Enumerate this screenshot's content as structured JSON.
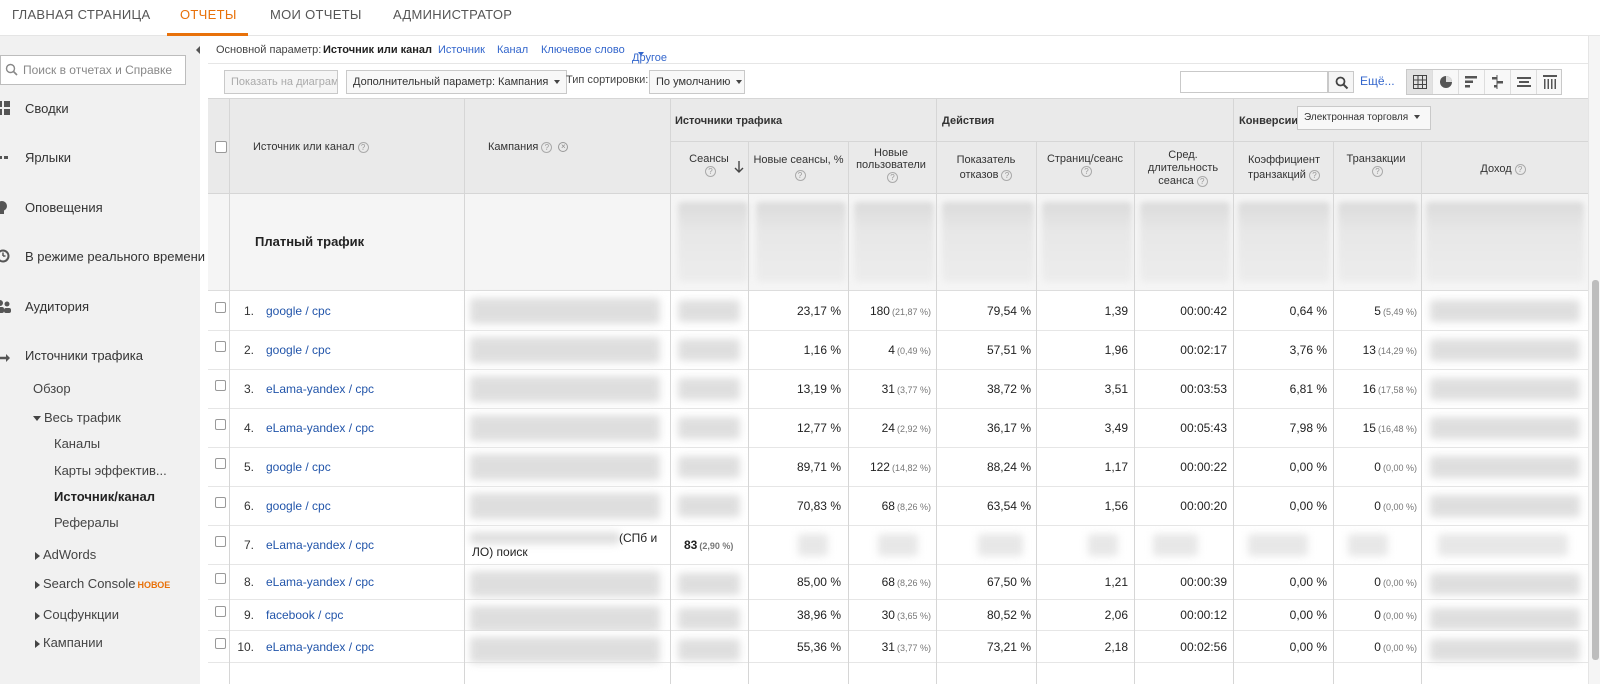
{
  "topnav": {
    "tabs": [
      {
        "label": "Главная страница",
        "active": false
      },
      {
        "label": "Отчеты",
        "active": true
      },
      {
        "label": "Мои отчеты",
        "active": false
      },
      {
        "label": "Администратор",
        "active": false
      }
    ],
    "accent_color": "#e8710a"
  },
  "sidebar": {
    "search_placeholder": "Поиск в отчетах и Справке",
    "items": [
      {
        "label": "Сводки",
        "icon": "grid-icon"
      },
      {
        "label": "Ярлыки",
        "icon": "shortcut-icon"
      },
      {
        "label": "Оповещения",
        "icon": "bulb-icon"
      },
      {
        "label": "В режиме реального времени",
        "icon": "clock-icon"
      },
      {
        "label": "Аудитория",
        "icon": "people-icon"
      },
      {
        "label": "Источники трафика",
        "icon": "acquisition-icon"
      }
    ],
    "sub": {
      "overview": "Обзор",
      "all_traffic": "Весь трафик",
      "channels": "Каналы",
      "treemaps": "Карты эффектив...",
      "source_medium": "Источник/канал",
      "referrals": "Рефералы",
      "adwords": "AdWords",
      "search_console": "Search Console",
      "new_badge": "НОВОЕ",
      "social": "Соцфункции",
      "campaigns": "Кампании"
    }
  },
  "params": {
    "label": "Основной параметр:",
    "current": "Источник или канал",
    "options": [
      "Источник",
      "Канал",
      "Ключевое слово",
      "Другое"
    ]
  },
  "toolbar": {
    "plot_button": "Показать на диаграмме",
    "secondary_dimension": "Дополнительный параметр: Кампания",
    "sort_label": "Тип сортировки:",
    "sort_value": "По умолчанию",
    "more": "Ещё..."
  },
  "table": {
    "headers": {
      "source": "Источник или канал",
      "campaign": "Кампания",
      "group_acquisition": "Источники трафика",
      "group_behavior": "Действия",
      "group_conversions": "Конверсии",
      "conversion_select": "Электронная торговля",
      "sessions": "Сеансы",
      "new_sessions": "Новые сеансы, %",
      "new_users": "Новые пользователи",
      "bounce": "Показатель отказов",
      "pages_session": "Страниц/сеанс",
      "avg_duration": "Сред. длительность сеанса",
      "conv_rate": "Коэффициент транзакций",
      "transactions": "Транзакции",
      "revenue": "Доход"
    },
    "summary_label": "Платный трафик",
    "rows": [
      {
        "n": "1.",
        "source": "google / cpc",
        "new_sessions": "23,17 %",
        "new_users": "180",
        "new_users_pct": "(21,87 %)",
        "bounce": "79,54 %",
        "pages": "1,39",
        "duration": "00:00:42",
        "conv": "0,64 %",
        "tx": "5",
        "tx_pct": "(5,49 %)"
      },
      {
        "n": "2.",
        "source": "google / cpc",
        "new_sessions": "1,16 %",
        "new_users": "4",
        "new_users_pct": "(0,49 %)",
        "bounce": "57,51 %",
        "pages": "1,96",
        "duration": "00:02:17",
        "conv": "3,76 %",
        "tx": "13",
        "tx_pct": "(14,29 %)"
      },
      {
        "n": "3.",
        "source": "eLama-yandex / cpc",
        "new_sessions": "13,19 %",
        "new_users": "31",
        "new_users_pct": "(3,77 %)",
        "bounce": "38,72 %",
        "pages": "3,51",
        "duration": "00:03:53",
        "conv": "6,81 %",
        "tx": "16",
        "tx_pct": "(17,58 %)"
      },
      {
        "n": "4.",
        "source": "eLama-yandex / cpc",
        "new_sessions": "12,77 %",
        "new_users": "24",
        "new_users_pct": "(2,92 %)",
        "bounce": "36,17 %",
        "pages": "3,49",
        "duration": "00:05:43",
        "conv": "7,98 %",
        "tx": "15",
        "tx_pct": "(16,48 %)"
      },
      {
        "n": "5.",
        "source": "google / cpc",
        "new_sessions": "89,71 %",
        "new_users": "122",
        "new_users_pct": "(14,82 %)",
        "bounce": "88,24 %",
        "pages": "1,17",
        "duration": "00:00:22",
        "conv": "0,00 %",
        "tx": "0",
        "tx_pct": "(0,00 %)"
      },
      {
        "n": "6.",
        "source": "google / cpc",
        "new_sessions": "70,83 %",
        "new_users": "68",
        "new_users_pct": "(8,26 %)",
        "bounce": "63,54 %",
        "pages": "1,56",
        "duration": "00:00:20",
        "conv": "0,00 %",
        "tx": "0",
        "tx_pct": "(0,00 %)"
      },
      {
        "n": "7.",
        "source": "eLama-yandex / cpc",
        "campaign_tail": "(СПб и",
        "campaign_tail2": "ЛО) поиск",
        "sessions": "83",
        "sessions_pct": "(2,90 %)"
      },
      {
        "n": "8.",
        "source": "eLama-yandex / cpc",
        "new_sessions": "85,00 %",
        "new_users": "68",
        "new_users_pct": "(8,26 %)",
        "bounce": "67,50 %",
        "pages": "1,21",
        "duration": "00:00:39",
        "conv": "0,00 %",
        "tx": "0",
        "tx_pct": "(0,00 %)"
      },
      {
        "n": "9.",
        "source": "facebook / cpc",
        "new_sessions": "38,96 %",
        "new_users": "30",
        "new_users_pct": "(3,65 %)",
        "bounce": "80,52 %",
        "pages": "2,06",
        "duration": "00:00:12",
        "conv": "0,00 %",
        "tx": "0",
        "tx_pct": "(0,00 %)"
      },
      {
        "n": "10.",
        "source": "eLama-yandex / cpc",
        "new_sessions": "55,36 %",
        "new_users": "31",
        "new_users_pct": "(3,77 %)",
        "bounce": "73,21 %",
        "pages": "2,18",
        "duration": "00:02:56",
        "conv": "0,00 %",
        "tx": "0",
        "tx_pct": "(0,00 %)"
      }
    ]
  }
}
